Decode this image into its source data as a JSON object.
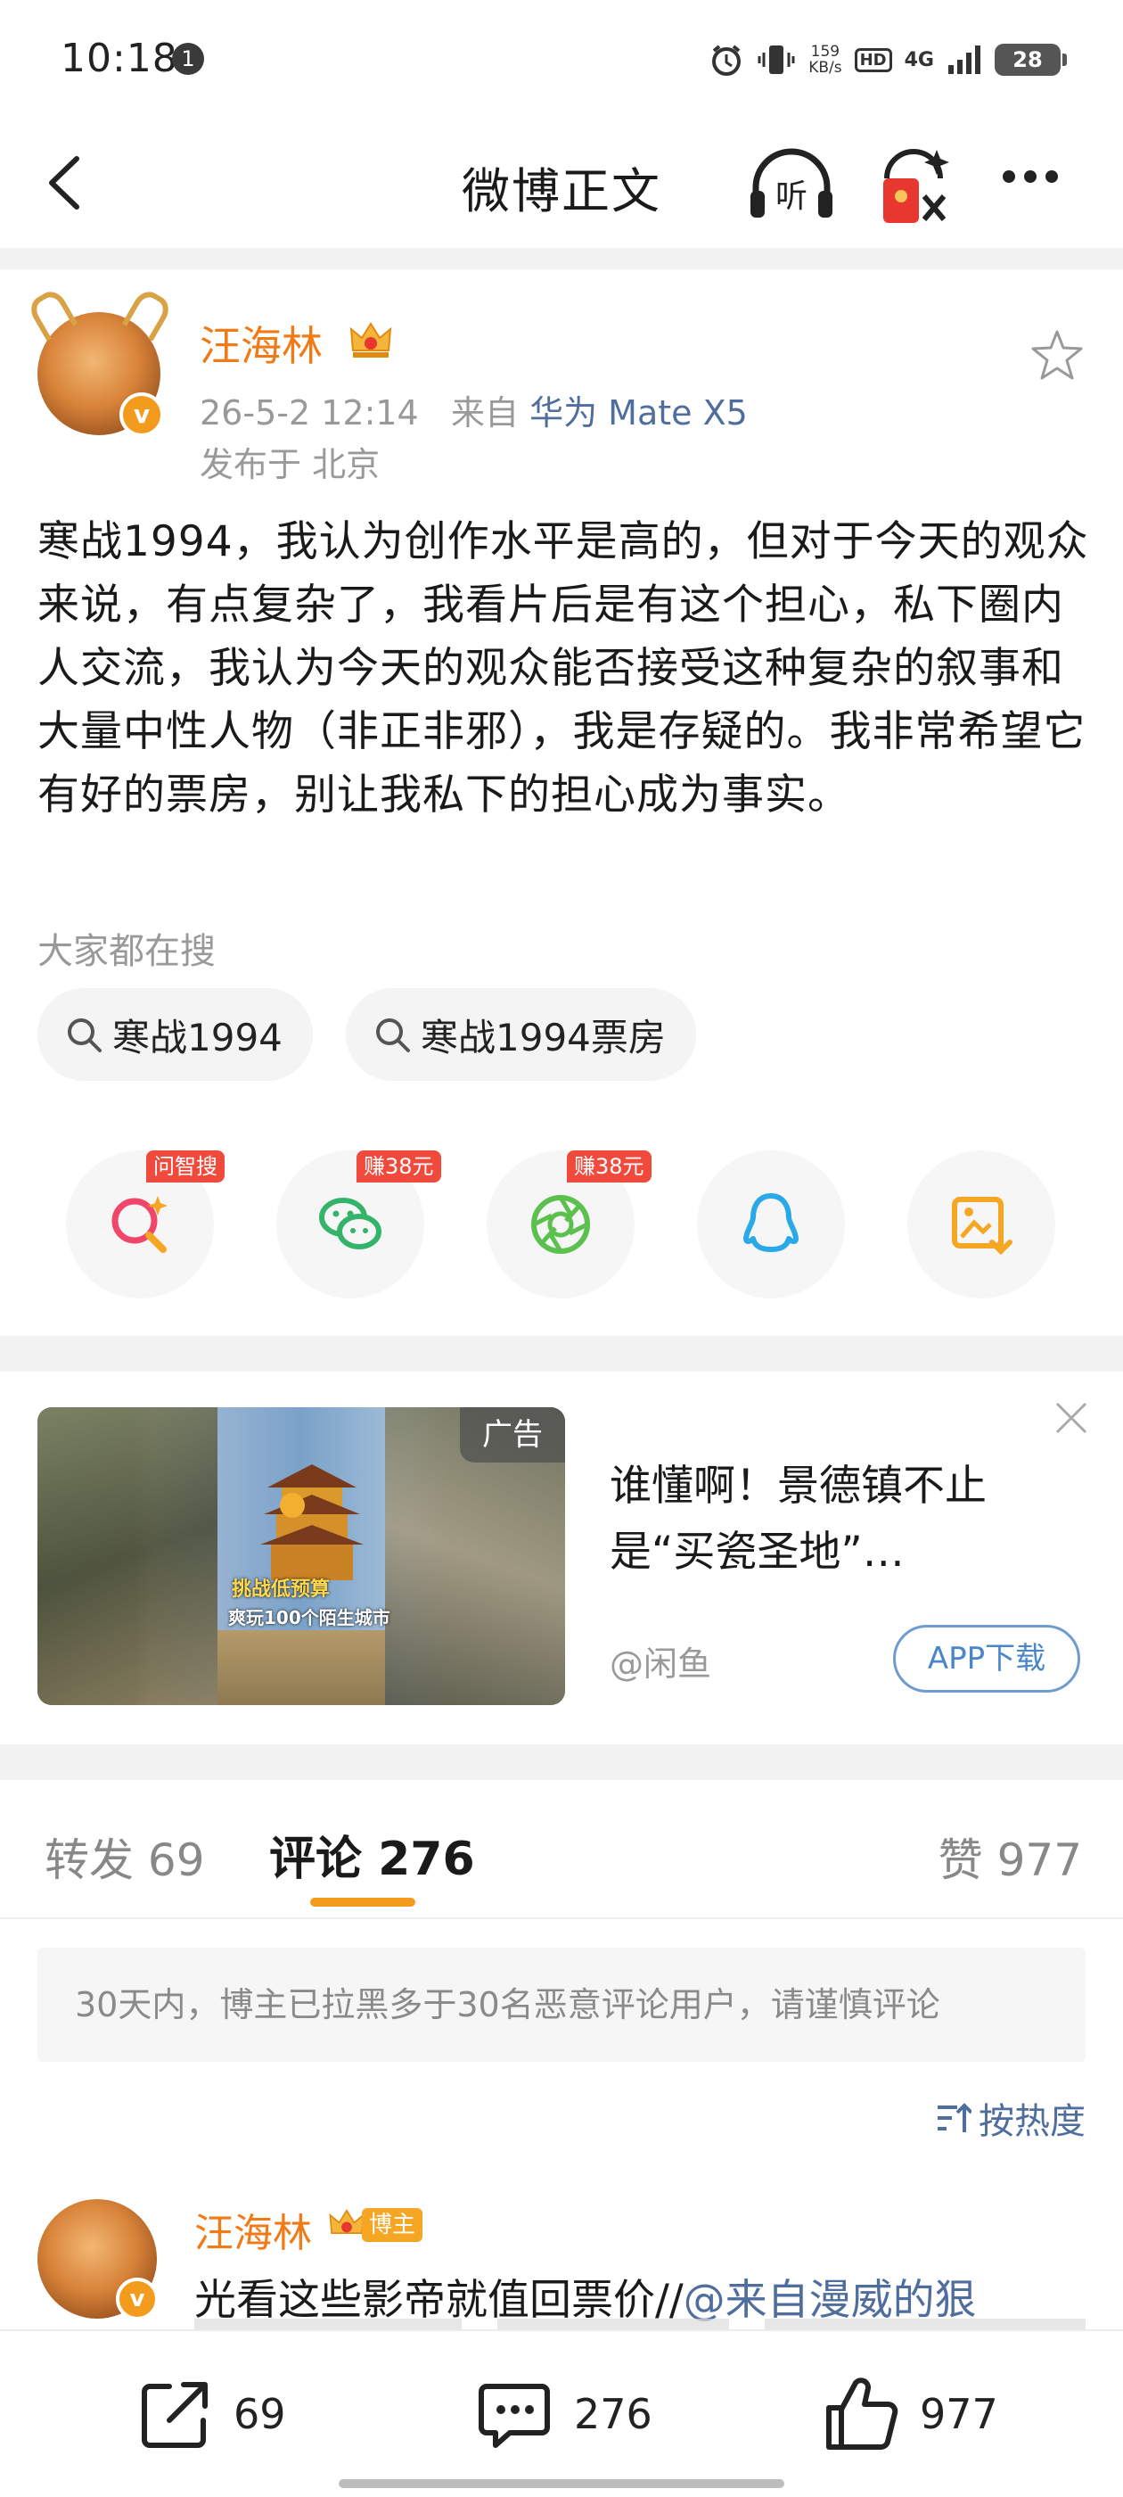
{
  "status_bar": {
    "time": "10:18",
    "notification_count": "1",
    "net_speed_value": "159",
    "net_speed_unit": "KB/s",
    "hd_label": "HD",
    "network_label": "4G",
    "battery": "28"
  },
  "header": {
    "title": "微博正文",
    "listen_label": "听"
  },
  "post": {
    "author": "汪海林",
    "time": "26-5-2 12:14",
    "source_prefix": "来自",
    "device": "华为 Mate X5",
    "location": "发布于 北京",
    "verified_mark": "v",
    "body": "寒战1994，我认为创作水平是高的，但对于今天的观众来说，有点复杂了，我看片后是有这个担心，私下圈内人交流，我认为今天的观众能否接受这种复杂的叙事和大量中性人物（非正非邪），我是存疑的。我非常希望它有好的票房，别让我私下的担心成为事实。"
  },
  "search": {
    "hint": "大家都在搜",
    "chips": [
      "寒战1994",
      "寒战1994票房"
    ]
  },
  "share": {
    "tags": [
      "问智搜",
      "赚38元",
      "赚38元"
    ]
  },
  "ad": {
    "tag": "广告",
    "title": "谁懂啊！景德镇不止是“买瓷圣地”…",
    "source": "@闲鱼",
    "button": "APP下载",
    "image_caption_1": "挑战低预算",
    "image_caption_2": "爽玩100个陌生城市"
  },
  "tabs": {
    "repost": "转发 69",
    "comments": "评论 276",
    "likes": "赞 977"
  },
  "comments_section": {
    "notice": "30天内，博主已拉黑多于30名恶意评论用户，请谨慎评论",
    "sort": "按热度"
  },
  "comment": {
    "author": "汪海林",
    "badge": "博主",
    "text": "光看这些影帝就值回票价//",
    "mention": "@来自漫威的狠"
  },
  "bottom_bar": {
    "repost_count": "69",
    "comment_count": "276",
    "like_count": "977"
  },
  "colors": {
    "accent_orange": "#f07a16",
    "link_blue": "#4f6e9e",
    "tag_red": "#f04a3c"
  }
}
